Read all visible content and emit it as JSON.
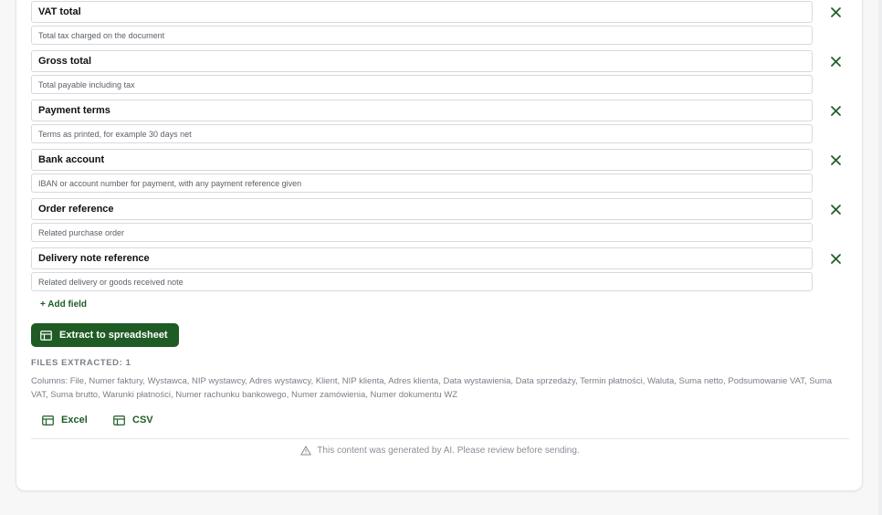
{
  "fields": [
    {
      "name": "VAT total",
      "description": "Total tax charged on the document"
    },
    {
      "name": "Gross total",
      "description": "Total payable including tax"
    },
    {
      "name": "Payment terms",
      "description": "Terms as printed, for example 30 days net"
    },
    {
      "name": "Bank account",
      "description": "IBAN or account number for payment, with any payment reference given"
    },
    {
      "name": "Order reference",
      "description": "Related purchase order"
    },
    {
      "name": "Delivery note reference",
      "description": "Related delivery or goods received note"
    }
  ],
  "add_field_label": "+ Add field",
  "extract_button_label": "Extract to spreadsheet",
  "files_extracted_label": "FILES EXTRACTED: 1",
  "columns_text": "Columns: File, Numer faktury, Wystawca, NIP wystawcy, Adres wystawcy, Klient, NIP klienta, Adres klienta, Data wystawienia, Data sprzedaży, Termin płatności, Waluta, Suma netto, Podsumowanie VAT, Suma VAT, Suma brutto, Warunki płatności, Numer rachunku bankowego, Numer zamówienia, Numer dokumentu WZ",
  "downloads": {
    "excel_label": "Excel",
    "csv_label": "CSV"
  },
  "ai_notice": "This content was generated by AI. Please review before sending.",
  "colors": {
    "accent": "#1f5b24",
    "muted_text": "#7a7f87",
    "border": "#d6d9dd"
  },
  "icons": {
    "remove": "close-icon",
    "extract": "table-icon",
    "excel": "table-icon",
    "csv": "table-icon",
    "notice": "warning-triangle-icon"
  }
}
